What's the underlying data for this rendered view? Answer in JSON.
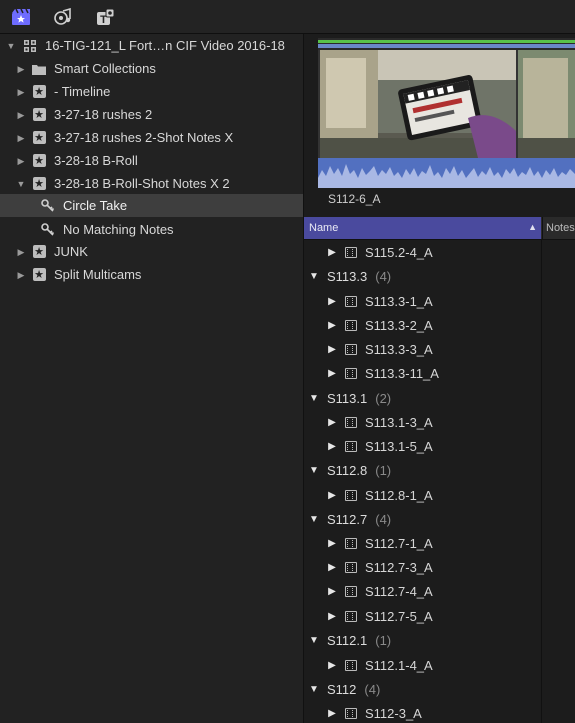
{
  "toolbar": {
    "icons": [
      "libraries-icon",
      "photos-audio-icon",
      "titles-generators-icon"
    ],
    "accent": "#6e6cff"
  },
  "sidebar": {
    "library_title": "16-TIG-121_L Fort…n CIF Video 2016-18",
    "items": [
      {
        "label": "Smart Collections",
        "icon": "folder-icon"
      },
      {
        "label": "- Timeline",
        "icon": "keyword-star-icon"
      },
      {
        "label": "3-27-18 rushes 2",
        "icon": "keyword-star-icon"
      },
      {
        "label": "3-27-18 rushes 2-Shot Notes X",
        "icon": "keyword-star-icon"
      },
      {
        "label": "3-28-18 B-Roll",
        "icon": "keyword-star-icon"
      },
      {
        "label": "3-28-18 B-Roll-Shot Notes X 2",
        "icon": "keyword-star-icon"
      },
      {
        "label": "Circle Take",
        "icon": "key-icon"
      },
      {
        "label": "No Matching Notes",
        "icon": "key-icon"
      },
      {
        "label": "JUNK",
        "icon": "keyword-star-icon"
      },
      {
        "label": "Split Multicams",
        "icon": "keyword-star-icon"
      }
    ]
  },
  "browser": {
    "clip_name": "S112-6_A",
    "columns": {
      "name": "Name",
      "notes": "Notes"
    },
    "rows": [
      {
        "kind": "clip",
        "label": "S115.2-4_A"
      },
      {
        "kind": "group",
        "label": "S113.3",
        "count": "(4)"
      },
      {
        "kind": "clip",
        "label": "S113.3-1_A"
      },
      {
        "kind": "clip",
        "label": "S113.3-2_A"
      },
      {
        "kind": "clip",
        "label": "S113.3-3_A"
      },
      {
        "kind": "clip",
        "label": "S113.3-11_A"
      },
      {
        "kind": "group",
        "label": "S113.1",
        "count": "(2)"
      },
      {
        "kind": "clip",
        "label": "S113.1-3_A"
      },
      {
        "kind": "clip",
        "label": "S113.1-5_A"
      },
      {
        "kind": "group",
        "label": "S112.8",
        "count": "(1)"
      },
      {
        "kind": "clip",
        "label": "S112.8-1_A"
      },
      {
        "kind": "group",
        "label": "S112.7",
        "count": "(4)"
      },
      {
        "kind": "clip",
        "label": "S112.7-1_A"
      },
      {
        "kind": "clip",
        "label": "S112.7-3_A"
      },
      {
        "kind": "clip",
        "label": "S112.7-4_A"
      },
      {
        "kind": "clip",
        "label": "S112.7-5_A"
      },
      {
        "kind": "group",
        "label": "S112.1",
        "count": "(1)"
      },
      {
        "kind": "clip",
        "label": "S112.1-4_A"
      },
      {
        "kind": "group",
        "label": "S112",
        "count": "(4)"
      },
      {
        "kind": "clip",
        "label": "S112-3_A"
      }
    ]
  }
}
